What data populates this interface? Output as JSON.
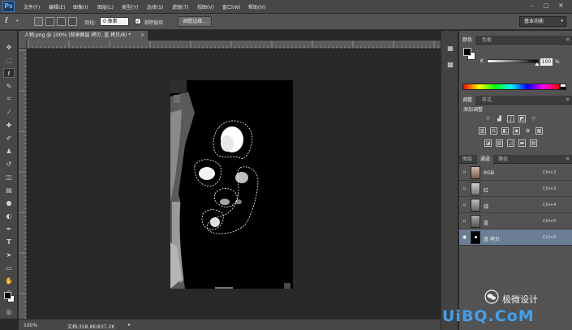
{
  "app": {
    "logo": "Ps"
  },
  "menubar": {
    "items": [
      "文件(F)",
      "编辑(E)",
      "图像(I)",
      "图层(L)",
      "类型(Y)",
      "选择(S)",
      "滤镜(T)",
      "视图(V)",
      "窗口(W)",
      "帮助(H)"
    ]
  },
  "options": {
    "feather_label": "羽化:",
    "feather_value": "0 像素",
    "antialias_label": "消除锯齿",
    "antialias_checked": true,
    "refine_edge_label": "调整边缘...",
    "workspace": "基本功能"
  },
  "document": {
    "tab_title": "人物.png @ 100% (背景图层 拷贝, 蓝 拷贝/8) *",
    "close_glyph": "×"
  },
  "status": {
    "zoom": "100%",
    "doc_size": "文档:358.8K/837.2K"
  },
  "panels": {
    "color": {
      "tabs": [
        "颜色",
        "色板"
      ],
      "active": "颜色",
      "k_label": "K",
      "k_value": "100",
      "k_unit": "%",
      "foreground": "#000000",
      "background": "#ffffff"
    },
    "adjustments": {
      "tabs": [
        "调整",
        "样式"
      ],
      "active": "调整",
      "title": "添加调整"
    },
    "channels": {
      "tabs": [
        "图层",
        "通道",
        "路径"
      ],
      "active": "通道",
      "rows": [
        {
          "name": "RGB",
          "shortcut": "Ctrl+2",
          "visible": false,
          "selected": false
        },
        {
          "name": "红",
          "shortcut": "Ctrl+3",
          "visible": false,
          "selected": false
        },
        {
          "name": "绿",
          "shortcut": "Ctrl+4",
          "visible": false,
          "selected": false
        },
        {
          "name": "蓝",
          "shortcut": "Ctrl+5",
          "visible": false,
          "selected": false
        },
        {
          "name": "蓝 拷贝",
          "shortcut": "Ctrl+6",
          "visible": true,
          "selected": true
        }
      ]
    }
  },
  "watermark": {
    "text": "极微设计",
    "site": "UiBQ.CoM"
  },
  "colors": {
    "selected_row": "#6b7e96",
    "watermark_blue": "#3fa0f0"
  }
}
